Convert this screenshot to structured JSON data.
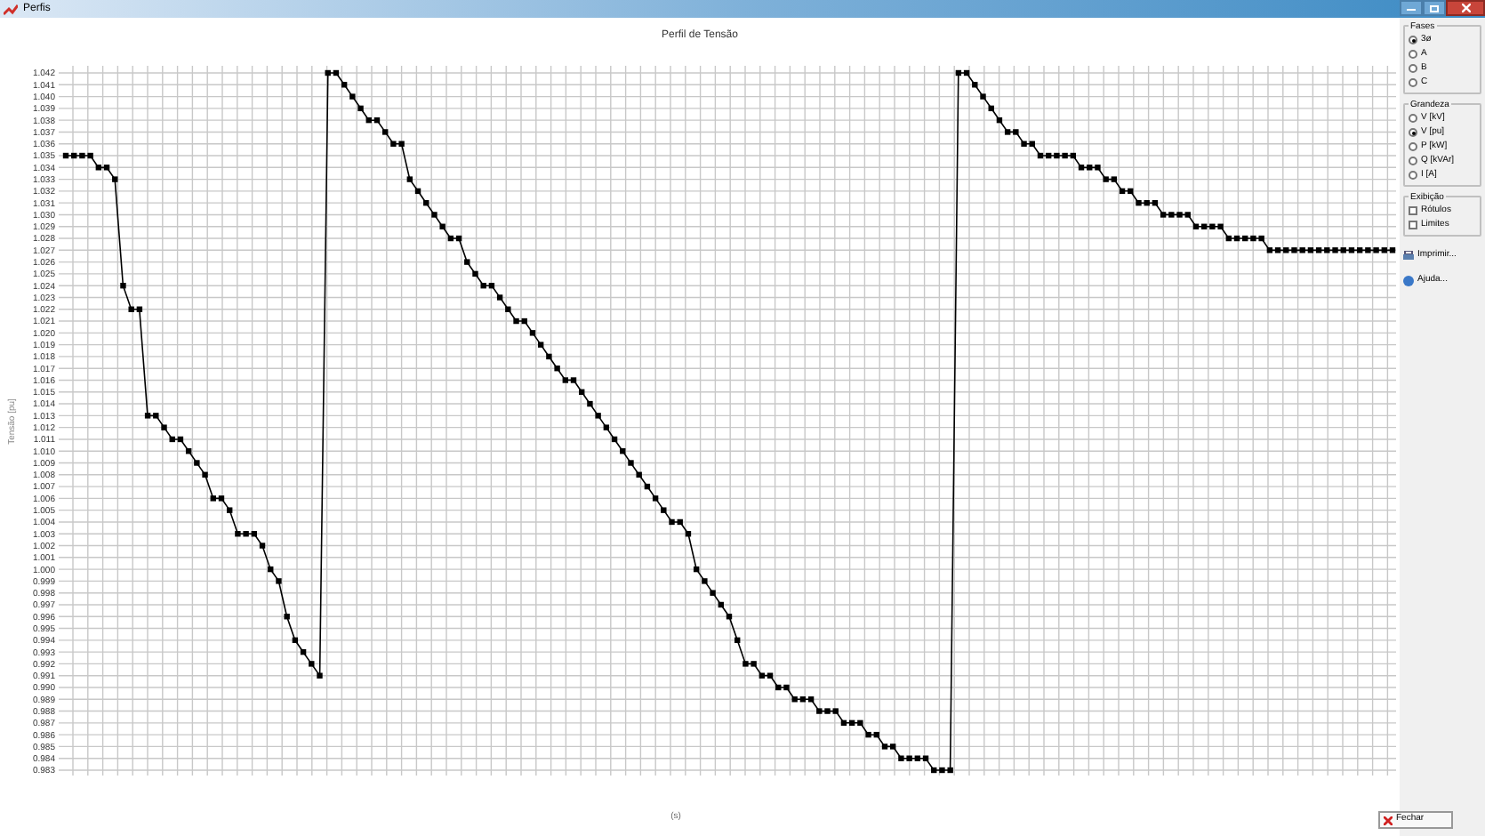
{
  "window": {
    "title": "Perfis"
  },
  "chart": {
    "title": "Perfil de Tensão",
    "chart_data": {
      "type": "line",
      "ylabel": "Tensão [pu]",
      "xlabel": "(s)",
      "ylim": [
        0.983,
        1.042
      ],
      "grid": true,
      "yticks": [
        1.042,
        1.041,
        {
          "value": 1.04,
          "label": "1.040"
        },
        1.039,
        1.038,
        1.037,
        1.036,
        1.035,
        1.034,
        1.033,
        1.032,
        1.031,
        {
          "value": 1.03,
          "label": "1.030"
        },
        1.029,
        1.028,
        1.027,
        1.026,
        1.025,
        1.024,
        1.023,
        1.022,
        1.021,
        {
          "value": 1.02,
          "label": "1.020"
        },
        1.019,
        1.018,
        1.017,
        1.016,
        1.015,
        1.014,
        1.013,
        1.012,
        1.011,
        {
          "value": 1.01,
          "label": "1.010"
        },
        1.009,
        1.008,
        1.007,
        1.006,
        1.005,
        1.004,
        1.003,
        1.002,
        1.001,
        {
          "value": 1.0,
          "label": "1.000"
        },
        0.999,
        0.998,
        0.997,
        0.996,
        0.995,
        0.994,
        0.993,
        0.992,
        0.991,
        {
          "value": 0.99,
          "label": "0.990"
        },
        0.989,
        0.988,
        0.987,
        0.986,
        0.985,
        0.984,
        0.983
      ],
      "series": [
        {
          "color": "#000000",
          "marker": "square",
          "values": [
            1.035,
            1.035,
            1.035,
            1.035,
            1.034,
            1.034,
            1.033,
            1.024,
            1.022,
            1.022,
            1.013,
            1.013,
            1.012,
            1.011,
            1.011,
            1.01,
            1.009,
            1.008,
            1.006,
            1.006,
            1.005,
            1.003,
            1.003,
            1.003,
            1.002,
            1.0,
            0.999,
            0.996,
            0.994,
            0.993,
            0.992,
            0.991,
            1.042,
            1.042,
            1.041,
            1.04,
            1.039,
            1.038,
            1.038,
            1.037,
            1.036,
            1.036,
            1.033,
            1.032,
            1.031,
            1.03,
            1.029,
            1.028,
            1.028,
            1.026,
            1.025,
            1.024,
            1.024,
            1.023,
            1.022,
            1.021,
            1.021,
            1.02,
            1.019,
            1.018,
            1.017,
            1.016,
            1.016,
            1.015,
            1.014,
            1.013,
            1.012,
            1.011,
            1.01,
            1.009,
            1.008,
            1.007,
            1.006,
            1.005,
            1.004,
            1.004,
            1.003,
            1.0,
            0.999,
            0.998,
            0.997,
            0.996,
            0.994,
            0.992,
            0.992,
            0.991,
            0.991,
            0.99,
            0.99,
            0.989,
            0.989,
            0.989,
            0.988,
            0.988,
            0.988,
            0.987,
            0.987,
            0.987,
            0.986,
            0.986,
            0.985,
            0.985,
            0.984,
            0.984,
            0.984,
            0.984,
            0.983,
            0.983,
            0.983,
            1.042,
            1.042,
            1.041,
            1.04,
            1.039,
            1.038,
            1.037,
            1.037,
            1.036,
            1.036,
            1.035,
            1.035,
            1.035,
            1.035,
            1.035,
            1.034,
            1.034,
            1.034,
            1.033,
            1.033,
            1.032,
            1.032,
            1.031,
            1.031,
            1.031,
            1.03,
            1.03,
            1.03,
            1.03,
            1.029,
            1.029,
            1.029,
            1.029,
            1.028,
            1.028,
            1.028,
            1.028,
            1.028,
            1.027,
            1.027,
            1.027,
            1.027,
            1.027,
            1.027,
            1.027,
            1.027,
            1.027,
            1.027,
            1.027,
            1.027,
            1.027,
            1.027,
            1.027,
            1.027
          ]
        }
      ]
    }
  },
  "panel": {
    "groups": [
      {
        "title": "Fases",
        "kind": "radio",
        "items": [
          {
            "label": "3ø",
            "selected": true
          },
          {
            "label": "A",
            "selected": false
          },
          {
            "label": "B",
            "selected": false
          },
          {
            "label": "C",
            "selected": false
          }
        ]
      },
      {
        "title": "Grandeza",
        "kind": "radio",
        "items": [
          {
            "label": "V [kV]",
            "selected": false
          },
          {
            "label": "V [pu]",
            "selected": true
          },
          {
            "label": "P [kW]",
            "selected": false
          },
          {
            "label": "Q [kVAr]",
            "selected": false
          },
          {
            "label": "I [A]",
            "selected": false
          }
        ]
      },
      {
        "title": "Exibição",
        "kind": "check",
        "items": [
          {
            "label": "Rótulos",
            "checked": false
          },
          {
            "label": "Limites",
            "checked": false
          }
        ]
      }
    ],
    "links": [
      "Imprimir...",
      "Ajuda..."
    ],
    "close_button": "Fechar"
  }
}
